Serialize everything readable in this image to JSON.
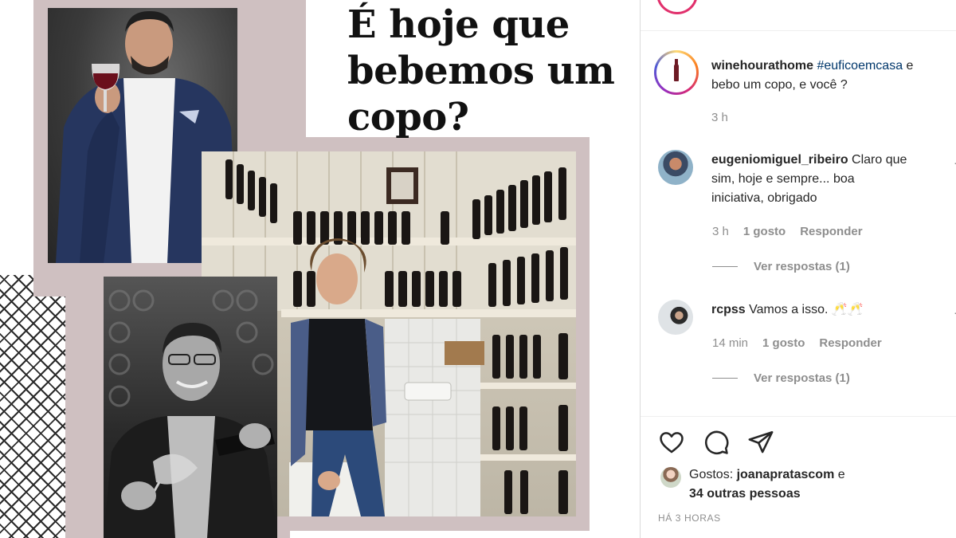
{
  "post": {
    "headline_lines": [
      "É hoje que",
      "bebemos um",
      "copo?"
    ]
  },
  "caption": {
    "username": "winehourathome",
    "hashtag": "#euficoemcasa",
    "text_after_hashtag_line1": " e",
    "text_line2": "bebo um copo, e você ?",
    "time": "3 h"
  },
  "comments": [
    {
      "username": "eugeniomiguel_ribeiro",
      "text_line1": " Claro que",
      "text_line2": "sim, hoje e sempre... boa",
      "text_line3": "iniciativa, obrigado",
      "time": "3 h",
      "likes": "1 gosto",
      "reply_label": "Responder",
      "view_replies": "Ver respostas (1)"
    },
    {
      "username": "rcpss",
      "text": " Vamos a isso. 🥂🥂",
      "time": "14 min",
      "likes": "1 gosto",
      "reply_label": "Responder",
      "view_replies": "Ver respostas (1)"
    }
  ],
  "actions": {
    "like_icon": "heart-icon",
    "comment_icon": "comment-icon",
    "share_icon": "share-icon"
  },
  "likes": {
    "prefix": "Gostos: ",
    "username": "joanapratascom",
    "suffix_line1": " e",
    "line2": "34 outras pessoas"
  },
  "time_ago": "HÁ 3 HORAS",
  "colors": {
    "mauve_frame": "#cfc0c1",
    "hashtag": "#00376b",
    "muted_text": "#8e8e8e"
  }
}
